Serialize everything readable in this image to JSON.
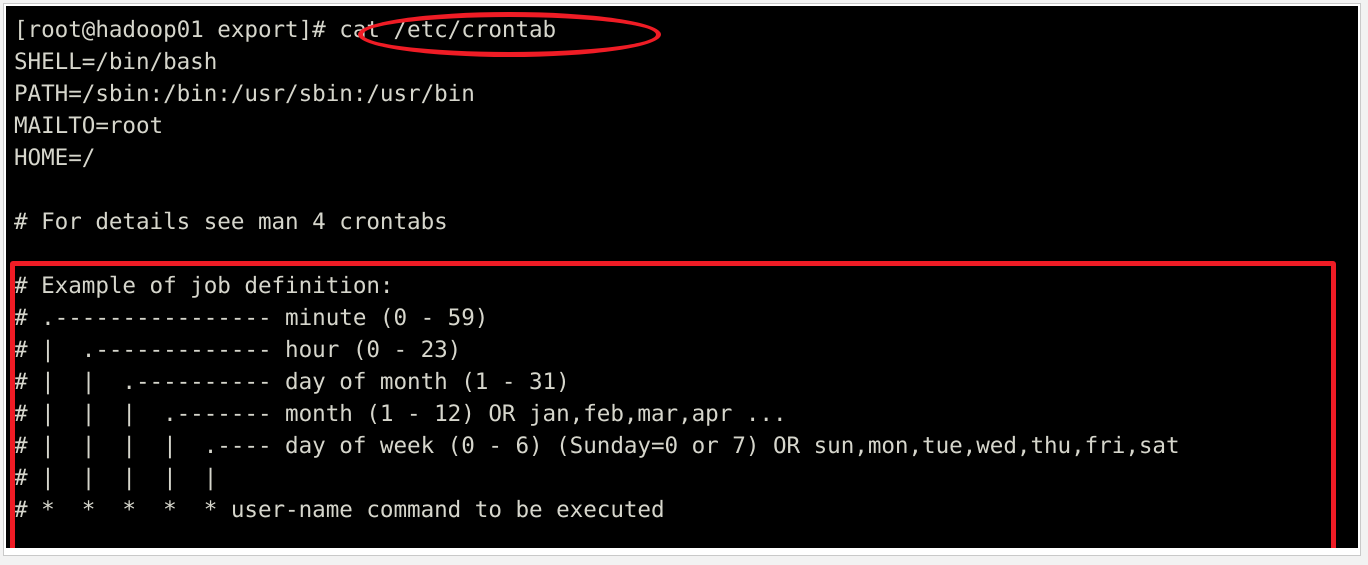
{
  "terminal": {
    "prompt": "[root@hadoop01 export]#",
    "command": " cat /etc/crontab",
    "lines": [
      {
        "text": "[root@hadoop01 export]# cat /etc/crontab"
      },
      {
        "text": "SHELL=/bin/bash"
      },
      {
        "text": "PATH=/sbin:/bin:/usr/sbin:/usr/bin"
      },
      {
        "text": "MAILTO=root"
      },
      {
        "text": "HOME=/"
      },
      {
        "text": ""
      },
      {
        "text": "# For details see man 4 crontabs"
      },
      {
        "text": ""
      },
      {
        "text": "# Example of job definition:"
      },
      {
        "text": "# .---------------- minute (0 - 59)"
      },
      {
        "text": "# |  .------------- hour (0 - 23)"
      },
      {
        "text": "# |  |  .---------- day of month (1 - 31)"
      },
      {
        "text": "# |  |  |  .------- month (1 - 12) OR jan,feb,mar,apr ..."
      },
      {
        "text": "# |  |  |  |  .---- day of week (0 - 6) (Sunday=0 or 7) OR sun,mon,tue,wed,thu,fri,sat"
      },
      {
        "text": "# |  |  |  |  |"
      },
      {
        "text": "# *  *  *  *  * user-name command to be executed"
      }
    ]
  },
  "annotations": {
    "ellipse": {
      "label": "command-highlight-ellipse",
      "target_text": "cat /etc/crontab",
      "color": "#ef1c25"
    },
    "box": {
      "label": "job-definition-highlight-box",
      "target_text": "# Example of job definition: ... # *  *  *  *  * user-name command to be executed",
      "color": "#ef1c25"
    }
  },
  "colors": {
    "terminal_background": "#000000",
    "terminal_foreground": "#d6d6cc",
    "annotation_red": "#ef1c25",
    "frame_background": "#f2f2f2"
  }
}
